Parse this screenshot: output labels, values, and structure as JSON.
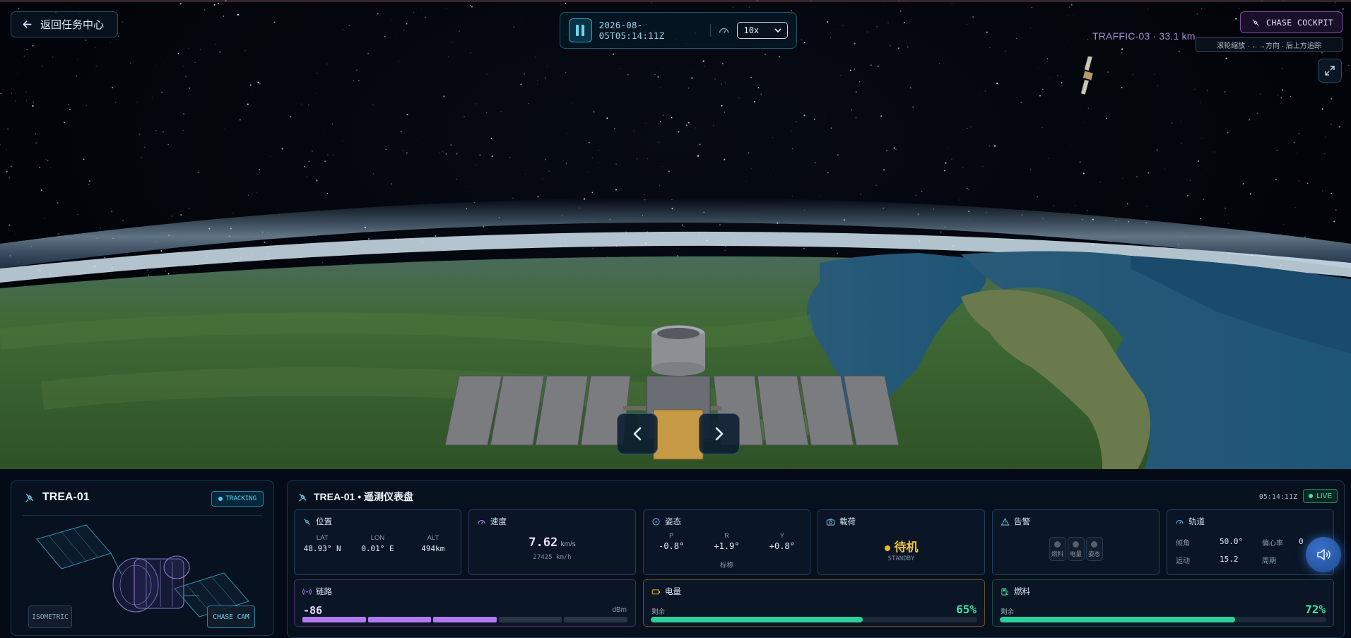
{
  "top": {
    "back_label": "返回任务中心",
    "timestamp": "2026-08-05T05:14:11Z",
    "speed": "10x",
    "chase_cockpit": "CHASE COCKPIT",
    "traffic": "TRAFFIC-03 · 33.1 km",
    "hint": "滚轮缩放 · ←→方向 · 后上方追踪"
  },
  "sat_card": {
    "name": "TREA-01",
    "status": "TRACKING",
    "mode_iso": "ISOMETRIC",
    "mode_chase": "CHASE CAM"
  },
  "dash": {
    "title": "TREA-01 • 遥测仪表盘",
    "clock": "05:14:11Z",
    "live": "LIVE",
    "position": {
      "label": "位置",
      "lat_label": "LAT",
      "lon_label": "LON",
      "alt_label": "ALT",
      "lat": "48.93° N",
      "lon": "0.01° E",
      "alt": "494km"
    },
    "velocity": {
      "label": "速度",
      "value": "7.62",
      "unit": "km/s",
      "sub": "27425 km/h"
    },
    "attitude": {
      "label": "姿态",
      "p_label": "P",
      "r_label": "R",
      "y_label": "Y",
      "p": "-0.8°",
      "r": "+1.9°",
      "y": "+0.8°",
      "mode": "标称"
    },
    "payload": {
      "label": "载荷",
      "state": "待机",
      "sub": "STANDBY"
    },
    "alarms": {
      "label": "告警",
      "items": [
        "燃料",
        "电量",
        "姿态"
      ]
    },
    "orbit": {
      "label": "轨道",
      "inc_label": "倾角",
      "inc": "50.0°",
      "ecc_label": "偏心率",
      "ecc": "0",
      "mm_label": "运动",
      "mm": "15.2",
      "period_label": "周期"
    },
    "link": {
      "label": "链路",
      "value": "-86",
      "unit": "dBm",
      "level": 3,
      "segments": 5
    },
    "power": {
      "label": "电量",
      "sub": "剩余",
      "pct": "65%",
      "value": 0.65
    },
    "fuel": {
      "label": "燃料",
      "sub": "剩余",
      "pct": "72%",
      "value": 0.72
    }
  },
  "colors": {
    "accent": "#2aa3c0",
    "purple": "#b37af0",
    "green": "#2ad09a",
    "amber": "#f2b42a"
  },
  "icons": [
    "arrow-left-icon",
    "pause-icon",
    "gauge-icon",
    "chevron-down-icon",
    "satellite-icon",
    "expand-icon",
    "chevron-left-icon",
    "chevron-right-icon",
    "speaker-icon"
  ]
}
